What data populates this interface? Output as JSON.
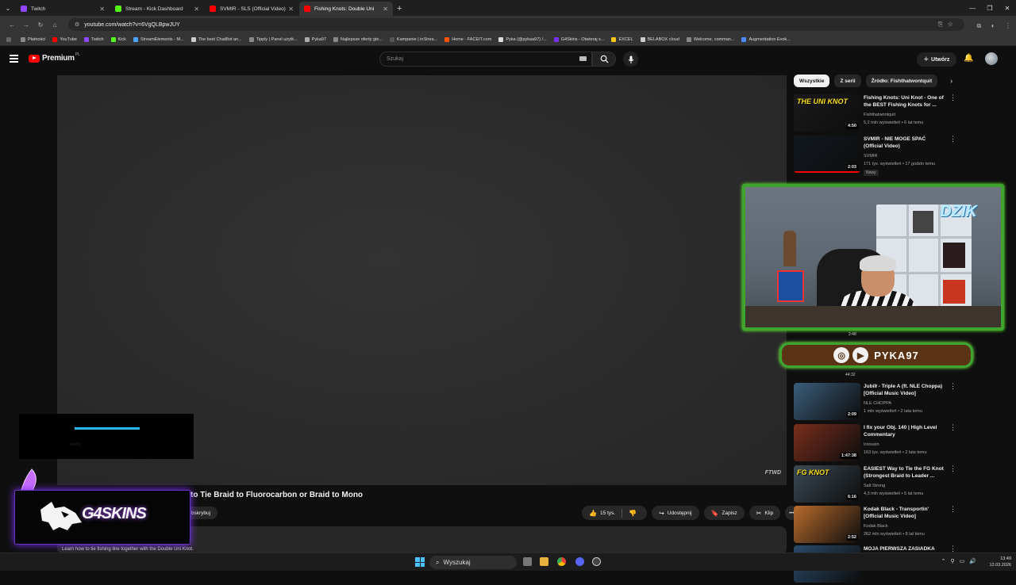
{
  "browser": {
    "tabs": [
      {
        "label": "Twitch",
        "color": "#9146ff",
        "active": false
      },
      {
        "label": "Stream - Kick Dashboard",
        "color": "#53fc18",
        "active": false
      },
      {
        "label": "SVMIR - SLS (Official Video) - Y",
        "color": "#ff0000",
        "active": false
      },
      {
        "label": "Fishing Knots: Double Uni",
        "color": "#ff0000",
        "active": true
      }
    ],
    "new_tab": "+",
    "url": "youtube.com/watch?v=6VgQLBpwJUY",
    "bookmarks": [
      "Płatności",
      "YouTube",
      "Twitch",
      "Kick",
      "StreamElements - M...",
      "The best ChatBot an...",
      "Tipply | Panel użytk...",
      "Pyka97",
      "Najlepsze oferty gie...",
      "Kampanie | inStrea...",
      "Home - FACEIT.com",
      "Pyka (@pykaa97) /...",
      "G4Skins - Otwieraj s...",
      "EXCEL",
      "BELABOX cloud",
      "Welcome, comman...",
      "Augmentation Evok..."
    ]
  },
  "youtube": {
    "logo_text": "Premium",
    "logo_region": "PL",
    "search_placeholder": "Szukaj",
    "create_label": "Utwórz",
    "video_title_partial": "to Tie Braid to Fluorocarbon or Braid to Mono",
    "subscribe_partial": "bskrybuj",
    "likes": "15 tys.",
    "share_label": "Udostępnij",
    "save_label": "Zapisz",
    "clip_label": "Klip",
    "watermark": "FTWD",
    "description": "Learn how to tie fishing line together with the Double Uni Knot.",
    "chips": [
      "Wszystkie",
      "Z serii",
      "Źródło: Fishthatwontquit"
    ],
    "recommendations": [
      {
        "title": "Fishing Knots: Uni Knot - One of the BEST Fishing Knots for ...",
        "channel": "Fishthatwontquit",
        "stats": "5,2 mln wyświetleń • 6 lat temu",
        "duration": "4:50",
        "thumb_text": "THE UNI KNOT",
        "thumb_color": "#1a1a1a"
      },
      {
        "title": "SVMIR - NIE MOGE SPAĆ (Official Video)",
        "channel": "SVMIR",
        "stats": "171 tys. wyświetleń • 17 godzin temu",
        "duration": "2:03",
        "badge": "Nowy",
        "thumb_color": "#121820"
      },
      {
        "title": "Jubilł - Triple A (ft. NLE Choppa) [Official Music Video]",
        "channel": "NLE CHOPPA",
        "stats": "1 mln wyświetleń • 2 lata temu",
        "duration": "2:09",
        "thumb_color": "#3a5d7a"
      },
      {
        "title": "I fix your Obj. 140 | High Level Commentary",
        "channel": "Iroouxin",
        "stats": "163 tys. wyświetleń • 2 lata temu",
        "duration": "1:47:38",
        "thumb_color": "#7a2e1c"
      },
      {
        "title": "EASIEST Way to Tie the FG Knot (Strongest Braid to Leader ...",
        "channel": "Salt Strong",
        "stats": "4,3 mln wyświetleń • 5 lat temu",
        "duration": "6:16",
        "thumb_text": "FG KNOT",
        "thumb_color": "#3b4a55"
      },
      {
        "title": "Kodak Black - Transportin' [Official Music Video]",
        "channel": "Kodak Black",
        "stats": "262 mln wyświetleń • 8 lat temu",
        "duration": "2:52",
        "thumb_color": "#b86b2c"
      },
      {
        "title": "MOJA PIERWSZA ZASIADKA",
        "channel": "",
        "stats": "",
        "duration": "",
        "thumb_color": "#2a4b6a"
      }
    ]
  },
  "overlay": {
    "sponsor_name": "G4SKINS",
    "cam_brand": "DZIK",
    "social_handle": "PYKA97",
    "cam_time_1": "2:48",
    "cam_time_2": "44:32",
    "loading_sub": "spotify"
  },
  "taskbar": {
    "search_label": "Wyszukaj",
    "time": "13:49",
    "date": "12.03.2026"
  }
}
